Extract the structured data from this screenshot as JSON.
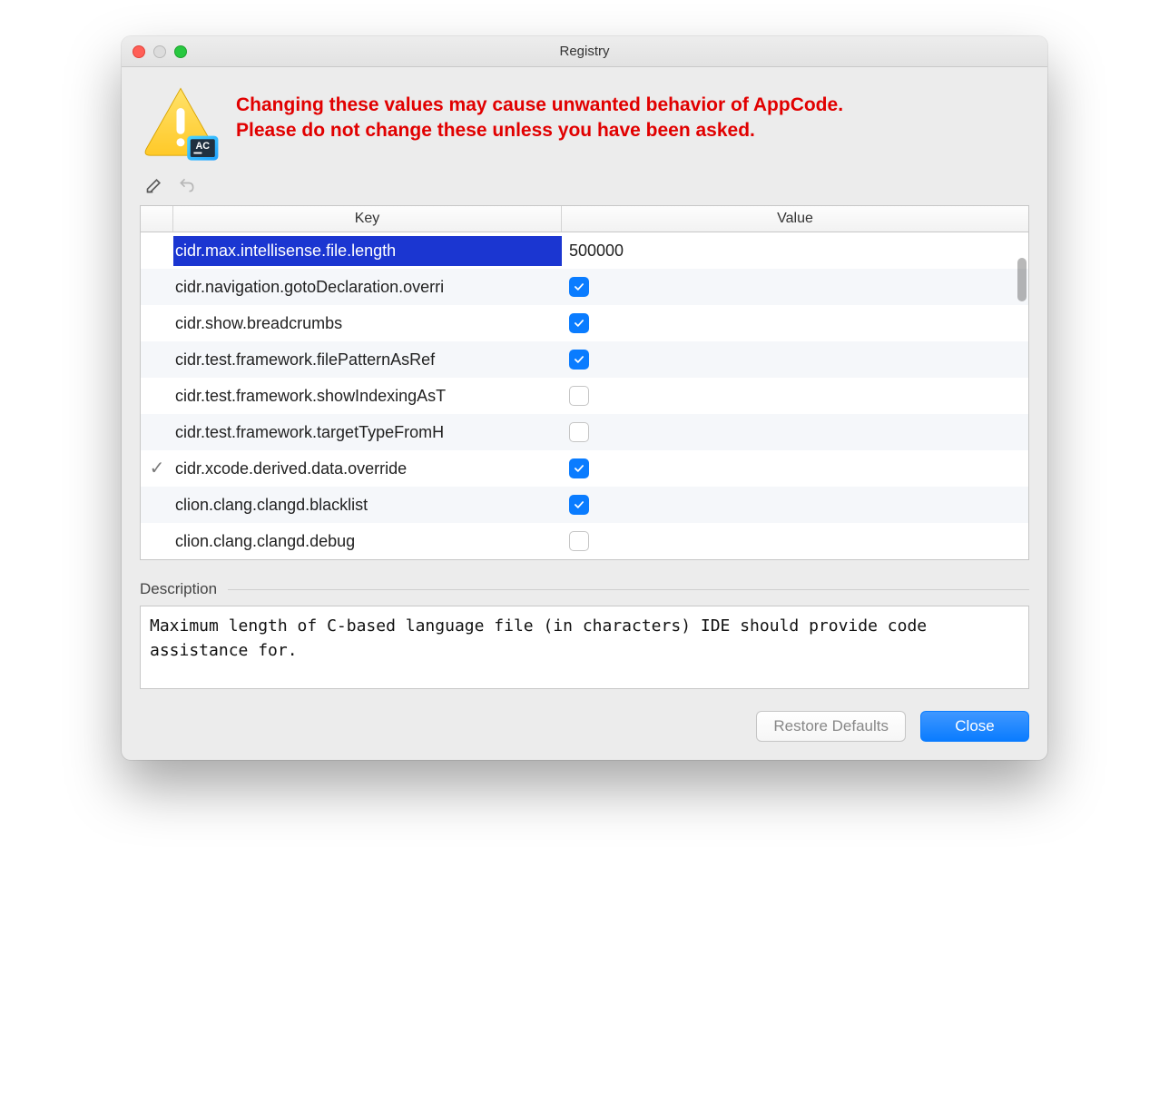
{
  "window": {
    "title": "Registry"
  },
  "warning": {
    "line1": "Changing these values may cause unwanted behavior of AppCode.",
    "line2": "Please do not change these unless you have been asked."
  },
  "table": {
    "headers": {
      "key": "Key",
      "value": "Value"
    },
    "rows": [
      {
        "modified": false,
        "selected": true,
        "key": "cidr.max.intellisense.file.length",
        "valueType": "text",
        "value": "500000"
      },
      {
        "modified": false,
        "selected": false,
        "key": "cidr.navigation.gotoDeclaration.overri",
        "valueType": "check",
        "checked": true
      },
      {
        "modified": false,
        "selected": false,
        "key": "cidr.show.breadcrumbs",
        "valueType": "check",
        "checked": true
      },
      {
        "modified": false,
        "selected": false,
        "key": "cidr.test.framework.filePatternAsRef",
        "valueType": "check",
        "checked": true
      },
      {
        "modified": false,
        "selected": false,
        "key": "cidr.test.framework.showIndexingAsT",
        "valueType": "check",
        "checked": false
      },
      {
        "modified": false,
        "selected": false,
        "key": "cidr.test.framework.targetTypeFromH",
        "valueType": "check",
        "checked": false
      },
      {
        "modified": true,
        "selected": false,
        "key": "cidr.xcode.derived.data.override",
        "valueType": "check",
        "checked": true
      },
      {
        "modified": false,
        "selected": false,
        "key": "clion.clang.clangd.blacklist",
        "valueType": "check",
        "checked": true
      },
      {
        "modified": false,
        "selected": false,
        "key": "clion.clang.clangd.debug",
        "valueType": "check",
        "checked": false
      }
    ]
  },
  "description": {
    "label": "Description",
    "text": "Maximum length of C-based language file (in characters) IDE should provide code assistance for."
  },
  "buttons": {
    "restore": "Restore Defaults",
    "close": "Close"
  }
}
